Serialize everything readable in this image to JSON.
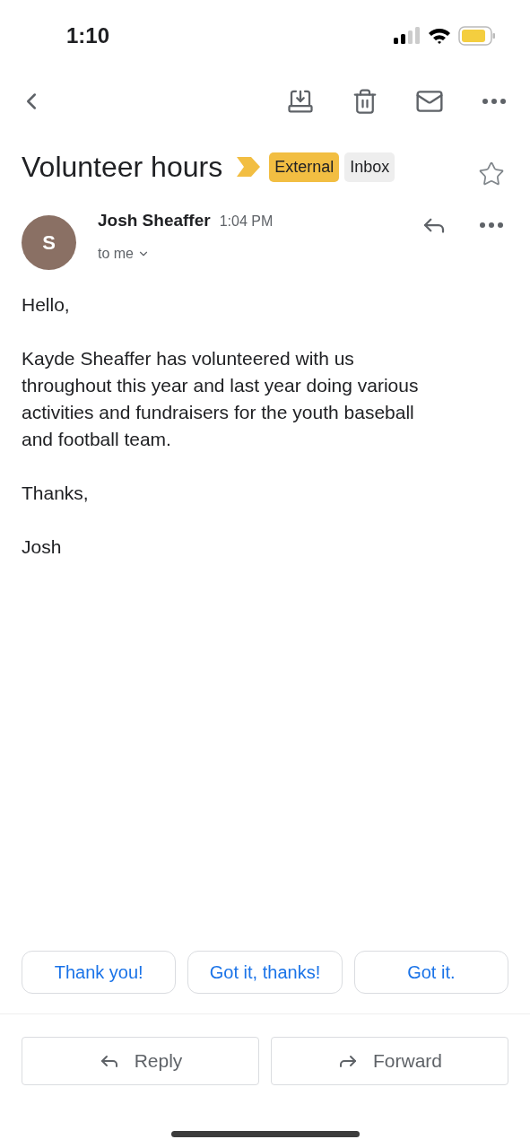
{
  "status_bar": {
    "time": "1:10"
  },
  "subject": {
    "title": "Volunteer hours",
    "important": true,
    "starred": false,
    "labels": [
      {
        "text": "External",
        "color": "#f2be42"
      },
      {
        "text": "Inbox",
        "color": "#eeeeee"
      }
    ]
  },
  "message": {
    "avatar_letter": "S",
    "sender": "Josh Sheaffer",
    "time": "1:04 PM",
    "recipient": "to me",
    "body": [
      "Hello,",
      "Kayde Sheaffer has volunteered with us throughout this year and last year doing various activities and fundraisers for the youth baseball and football team.",
      "Thanks,",
      "Josh"
    ]
  },
  "smart_replies": [
    "Thank you!",
    "Got it, thanks!",
    "Got it."
  ],
  "actions": [
    {
      "kind": "reply",
      "label": "Reply"
    },
    {
      "kind": "forward",
      "label": "Forward"
    }
  ]
}
